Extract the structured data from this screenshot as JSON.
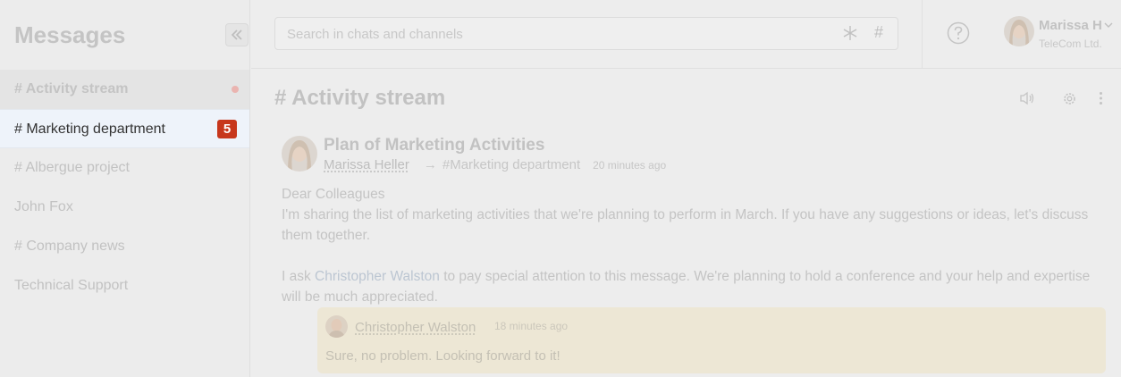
{
  "sidebar": {
    "title": "Messages",
    "items": [
      {
        "label": "# Activity stream",
        "state": "dim",
        "dot": true
      },
      {
        "label": "# Marketing department",
        "state": "active",
        "badge": "5"
      },
      {
        "label": "# Albergue project",
        "state": "normal"
      },
      {
        "label": "John Fox",
        "state": "normal"
      },
      {
        "label": "# Company news",
        "state": "normal"
      },
      {
        "label": "Technical Support",
        "state": "normal"
      }
    ]
  },
  "search": {
    "placeholder": "Search in chats and channels"
  },
  "user": {
    "name": "Marissa H",
    "company": "TeleCom Ltd."
  },
  "channel": {
    "title": "# Activity stream"
  },
  "post": {
    "title": "Plan of Marketing Activities",
    "author": "Marissa Heller",
    "target": "#Marketing department",
    "time": "20 minutes ago",
    "greeting": "Dear Colleagues",
    "para1": "I'm sharing the list of marketing activities that we're planning to perform in March. If you have any suggestions or ideas, let's discuss them together.",
    "para2_before": "I ask ",
    "para2_mention": "Christopher Walston",
    "para2_after": " to pay special attention to this message. We're planning to hold a conference and your help and expertise will be much appreciated."
  },
  "reply": {
    "author": "Christopher Walston",
    "time": "18 minutes ago",
    "text": "Sure, no problem. Looking forward to it!"
  },
  "colors": {
    "badge": "#c7371c",
    "active_item_bg": "#eef3fa",
    "reply_bg": "#ede7d5"
  }
}
